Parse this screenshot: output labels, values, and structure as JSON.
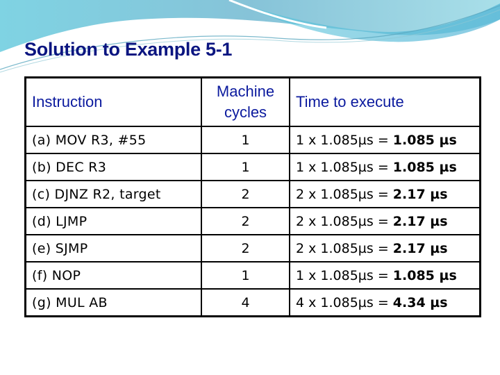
{
  "slide": {
    "title": "Solution to Example 5-1",
    "theme_colors": {
      "title": "#0b1580",
      "header_text": "#0b1a9e",
      "swoosh_light": "#a8dde8",
      "swoosh_dark": "#4fb8d6"
    }
  },
  "table": {
    "headers": {
      "instruction": "Instruction",
      "cycles_line1": "Machine",
      "cycles_line2": "cycles",
      "time": "Time to execute"
    },
    "rows": [
      {
        "instruction": "(a) MOV  R3, #55",
        "cycles": "1",
        "calc": "1 x 1.085µs = ",
        "result": "1.085 µs"
      },
      {
        "instruction": "(b) DEC  R3",
        "cycles": "1",
        "calc": "1 x 1.085µs = ",
        "result": "1.085 µs"
      },
      {
        "instruction": "(c) DJNZ  R2, target",
        "cycles": "2",
        "calc": "2 x 1.085µs = ",
        "result": "2.17 µs"
      },
      {
        "instruction": "(d) LJMP",
        "cycles": "2",
        "calc": "2 x 1.085µs = ",
        "result": "2.17 µs"
      },
      {
        "instruction": "(e) SJMP",
        "cycles": "2",
        "calc": "2 x 1.085µs = ",
        "result": "2.17 µs"
      },
      {
        "instruction": "(f) NOP",
        "cycles": "1",
        "calc": "1 x 1.085µs = ",
        "result": "1.085 µs"
      },
      {
        "instruction": "(g) MUL  AB",
        "cycles": "4",
        "calc": "4 x 1.085µs = ",
        "result": "4.34 µs"
      }
    ]
  }
}
